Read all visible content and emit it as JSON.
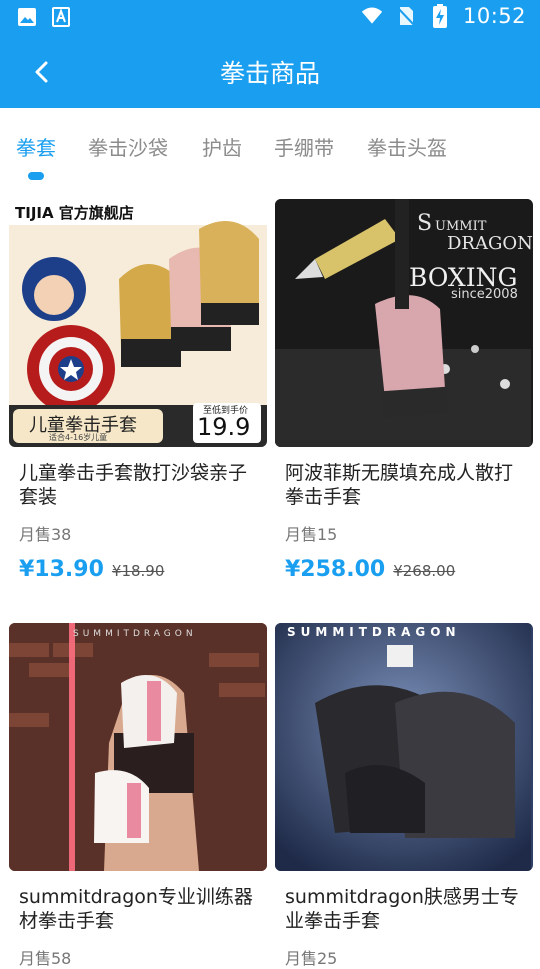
{
  "status_bar": {
    "time": "10:52"
  },
  "header": {
    "title": "拳击商品"
  },
  "tabs": [
    {
      "label": "拳套",
      "active": true
    },
    {
      "label": "拳击沙袋",
      "active": false
    },
    {
      "label": "护齿",
      "active": false
    },
    {
      "label": "手绷带",
      "active": false
    },
    {
      "label": "拳击头盔",
      "active": false
    }
  ],
  "products": [
    {
      "title": "儿童拳击手套散打沙袋亲子套装",
      "sales": "月售38",
      "price": "¥13.90",
      "original_price": "¥18.90",
      "image_text": {
        "brand": "TIJIA 官方旗舰店",
        "name": "儿童拳击手套",
        "age": "适合4-16岁儿童",
        "promo": "至低到手价",
        "price": "19.9"
      }
    },
    {
      "title": "阿波菲斯无膜填充成人散打拳击手套",
      "sales": "月售15",
      "price": "¥258.00",
      "original_price": "¥268.00",
      "image_text": {
        "brand_line1": "UMMIT",
        "brand_line2": "DRAGON",
        "boxing": "BOXING",
        "since": "since2008"
      }
    },
    {
      "title": "summitdragon专业训练器材拳击手套",
      "sales": "月售58",
      "price": "",
      "original_price": "",
      "image_text": {
        "brand": "SUMMITDRAGON"
      }
    },
    {
      "title": "summitdragon肤感男士专业拳击手套",
      "sales": "月售25",
      "price": "",
      "original_price": "",
      "image_text": {
        "brand": "SUMMITDRAGON"
      }
    }
  ],
  "colors": {
    "primary": "#1a9ff0",
    "text": "#222222",
    "muted": "#8c8c8c"
  }
}
